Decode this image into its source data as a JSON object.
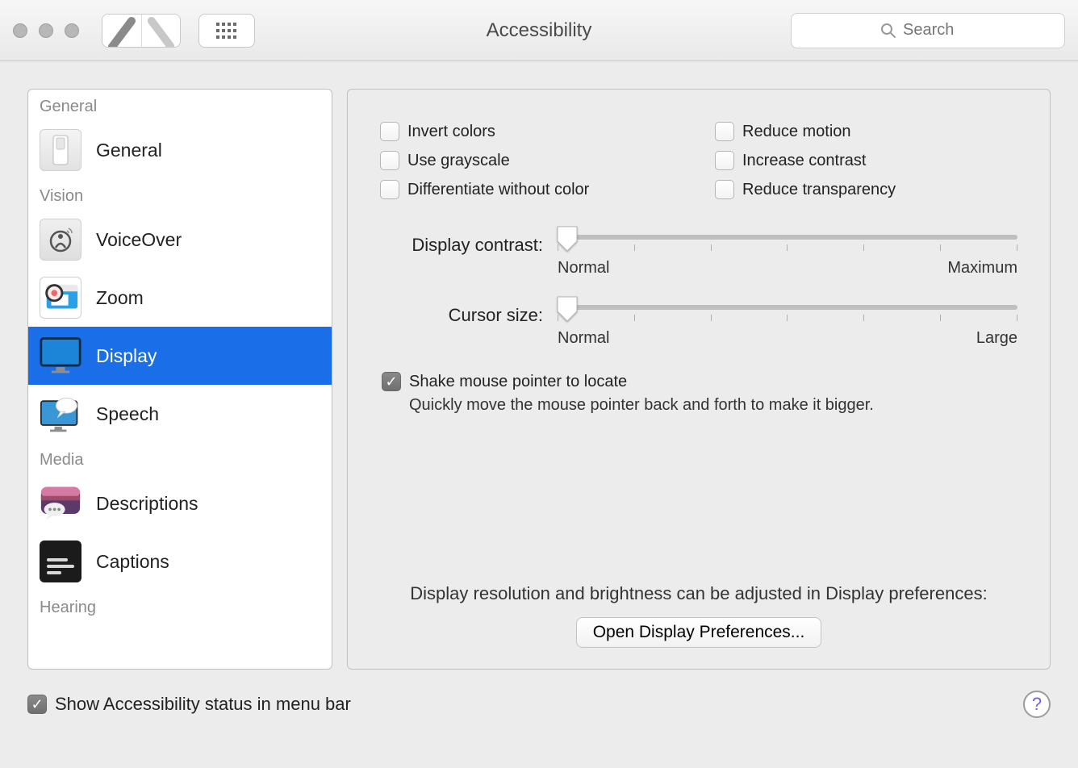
{
  "window": {
    "title": "Accessibility",
    "search_placeholder": "Search"
  },
  "sidebar": {
    "sections": [
      {
        "header": "General",
        "items": [
          {
            "id": "general",
            "label": "General",
            "selected": false
          }
        ]
      },
      {
        "header": "Vision",
        "items": [
          {
            "id": "voiceover",
            "label": "VoiceOver",
            "selected": false
          },
          {
            "id": "zoom",
            "label": "Zoom",
            "selected": false
          },
          {
            "id": "display",
            "label": "Display",
            "selected": true
          },
          {
            "id": "speech",
            "label": "Speech",
            "selected": false
          }
        ]
      },
      {
        "header": "Media",
        "items": [
          {
            "id": "descriptions",
            "label": "Descriptions",
            "selected": false
          },
          {
            "id": "captions",
            "label": "Captions",
            "selected": false
          }
        ]
      },
      {
        "header": "Hearing",
        "items": []
      }
    ]
  },
  "panel": {
    "checks": {
      "invert_colors": {
        "label": "Invert colors",
        "checked": false
      },
      "use_grayscale": {
        "label": "Use grayscale",
        "checked": false
      },
      "differentiate": {
        "label": "Differentiate without color",
        "checked": false
      },
      "reduce_motion": {
        "label": "Reduce motion",
        "checked": false
      },
      "increase_contrast": {
        "label": "Increase contrast",
        "checked": false
      },
      "reduce_transparency": {
        "label": "Reduce transparency",
        "checked": false
      }
    },
    "sliders": {
      "contrast": {
        "label": "Display contrast:",
        "min_label": "Normal",
        "max_label": "Maximum",
        "value": 0
      },
      "cursor": {
        "label": "Cursor size:",
        "min_label": "Normal",
        "max_label": "Large",
        "value": 0
      }
    },
    "shake": {
      "label": "Shake mouse pointer to locate",
      "checked": true,
      "description": "Quickly move the mouse pointer back and forth to make it bigger."
    },
    "note": "Display resolution and brightness can be adjusted in Display preferences:",
    "open_button": "Open Display Preferences..."
  },
  "footer": {
    "show_status": {
      "label": "Show Accessibility status in menu bar",
      "checked": true
    }
  }
}
